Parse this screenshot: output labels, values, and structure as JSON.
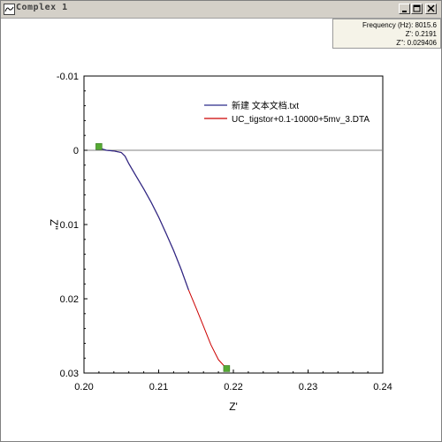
{
  "window": {
    "title": "Complex 1",
    "icon": "complex-plot-icon",
    "controls": [
      "minimize-icon",
      "maximize-icon",
      "close-icon"
    ]
  },
  "readout": {
    "frequency": "Frequency (Hz): 8015.6",
    "z_real": "Z': 0.2191",
    "z_imag": "Z'': 0.029406"
  },
  "colors": {
    "series1": "#2a2a8a",
    "series2": "#cc0000",
    "marker": "#55aa33",
    "axis": "#000000",
    "zero_line": "#808080"
  },
  "chart_data": {
    "type": "line",
    "title": "",
    "xlabel": "Z'",
    "ylabel": "Z''",
    "xlim": [
      0.2,
      0.24
    ],
    "ylim": [
      -0.01,
      0.03
    ],
    "y_inverted": true,
    "x_ticks": [
      "0.20",
      "0.21",
      "0.22",
      "0.23",
      "0.24"
    ],
    "y_ticks": [
      "-0.01",
      "0",
      "0.01",
      "0.02",
      "0.03"
    ],
    "legend_position": "top-right",
    "series": [
      {
        "name": "新建 文本文档.txt",
        "color": "#2a2a8a",
        "x": [
          0.202,
          0.203,
          0.204,
          0.205,
          0.2055,
          0.206,
          0.207,
          0.208,
          0.209,
          0.21,
          0.211,
          0.212,
          0.213,
          0.214
        ],
        "y": [
          -0.0003,
          0.0,
          0.0001,
          0.0003,
          0.0008,
          0.0018,
          0.0035,
          0.0052,
          0.007,
          0.009,
          0.0112,
          0.0135,
          0.016,
          0.0188
        ]
      },
      {
        "name": "UC_tigstor+0.1-10000+5mv_3.DTA",
        "color": "#cc0000",
        "x": [
          0.202,
          0.203,
          0.204,
          0.205,
          0.2055,
          0.206,
          0.207,
          0.208,
          0.209,
          0.21,
          0.211,
          0.212,
          0.213,
          0.214,
          0.215,
          0.216,
          0.217,
          0.218,
          0.2191
        ],
        "y": [
          -0.0003,
          0.0,
          0.0001,
          0.0003,
          0.0008,
          0.0018,
          0.0035,
          0.0052,
          0.007,
          0.009,
          0.0112,
          0.0135,
          0.016,
          0.0188,
          0.0212,
          0.0237,
          0.0262,
          0.0282,
          0.0294
        ]
      }
    ],
    "markers": [
      {
        "x": 0.202,
        "y": -0.0005
      },
      {
        "x": 0.2191,
        "y": 0.0294
      }
    ]
  }
}
